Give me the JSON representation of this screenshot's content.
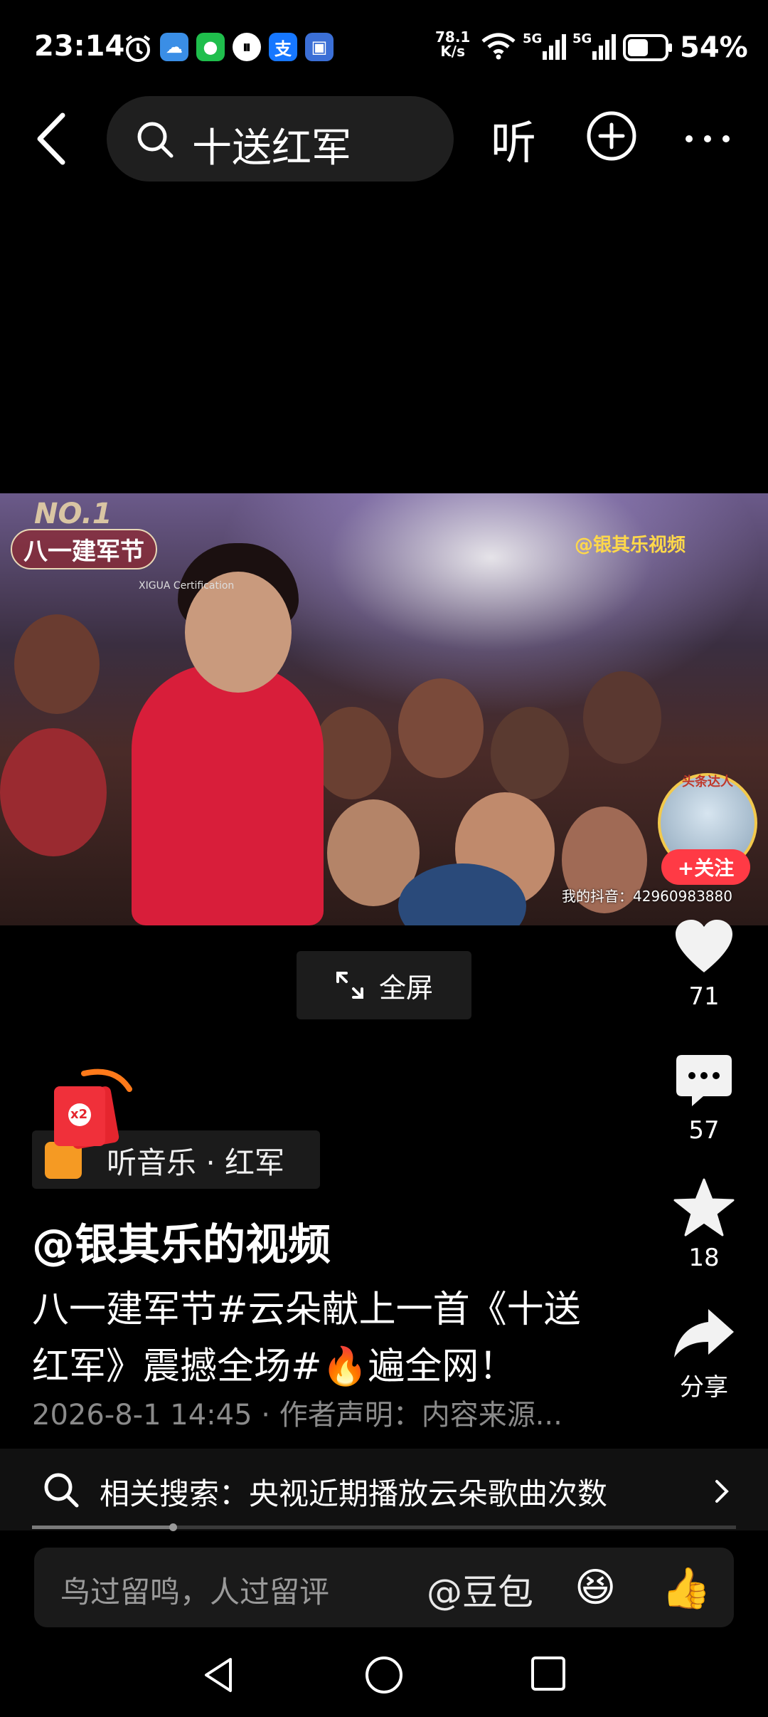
{
  "status_bar": {
    "time": "23:14",
    "net_speed_value": "78.1",
    "net_speed_unit": "K/s",
    "network_1": "5G",
    "network_2": "5G",
    "battery": "54%"
  },
  "top_bar": {
    "search_query": "十送红军",
    "listen_label": "听"
  },
  "video": {
    "rank_badge": "NO.1",
    "festival_tag": "八一建军节",
    "certification": "XIGUA Certification",
    "channel_watermark": "@银其乐视频",
    "creator_badge": "头条达人",
    "follow_label": "+关注",
    "douyin_id": "我的抖音：42960983880"
  },
  "fullscreen_label": "全屏",
  "actions": {
    "likes": "71",
    "comments": "57",
    "favorites": "18",
    "share_label": "分享"
  },
  "redpacket_multiplier": "x2",
  "music_chip": "听音乐 · 红军",
  "author": "@银其乐的视频",
  "description": "八一建军节#云朵献上一首《十送红军》震撼全场#🔥遍全网！",
  "meta": "2026-8-1 14:45 · 作者声明：内容来源...",
  "related_search": {
    "label": "相关搜索：央视近期播放云朵歌曲次数",
    "progress": 0.2
  },
  "comment_bar": {
    "placeholder": "鸟过留鸣，人过留评",
    "doubao": "@豆包",
    "emoji": "😆",
    "thumb": "👍"
  }
}
